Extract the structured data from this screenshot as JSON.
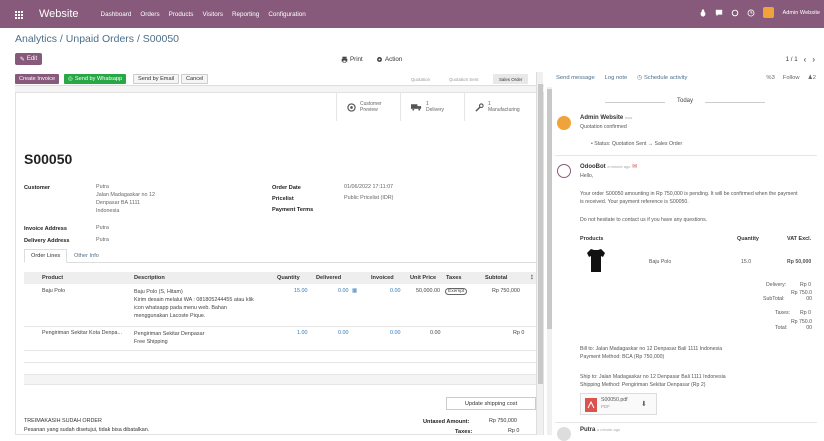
{
  "topbar": {
    "brand": "Website",
    "menus": [
      "Dashboard",
      "Orders",
      "Products",
      "Visitors",
      "Reporting",
      "Configuration"
    ],
    "user_name": "Admin Website"
  },
  "breadcrumb": "Analytics / Unpaid Orders / S00050",
  "control": {
    "edit": "Edit",
    "print": "Print",
    "action": "Action",
    "pager": "1 / 1"
  },
  "statusbar": {
    "buttons": [
      "Create Invoice",
      "Send by Whatsapp",
      "Send by Email",
      "Cancel"
    ],
    "stages": [
      "Quotation",
      "Quotation Sent",
      "Sales Order"
    ]
  },
  "smart_buttons": [
    {
      "top": "Customer",
      "bottom": "Preview"
    },
    {
      "top": "1",
      "bottom": "Delivery"
    },
    {
      "top": "1",
      "bottom": "Manufacturing"
    }
  ],
  "order": {
    "number": "S00050",
    "customer_label": "Customer",
    "customer_lines": [
      "Putra",
      "Jalan Madagaskar no 12",
      "Denpasar BA 1111",
      "Indonesia"
    ],
    "invoice_label": "Invoice Address",
    "invoice_value": "Putra",
    "delivery_label": "Delivery Address",
    "delivery_value": "Putra",
    "date_label": "Order Date",
    "date_value": "01/06/2022 17:11:07",
    "pricelist_label": "Pricelist",
    "pricelist_value": "Public Pricelist (IDR)",
    "terms_label": "Payment Terms"
  },
  "tabs": [
    "Order Lines",
    "Other Info"
  ],
  "columns": [
    "Product",
    "Description",
    "Quantity",
    "Delivered",
    "Invoiced",
    "Unit Price",
    "Taxes",
    "Subtotal"
  ],
  "lines": [
    {
      "product": "Baju Polo",
      "desc": [
        "Baju Polo (S, Hitam)",
        "Kirim desain melalui WA : 081805244455 atau klik",
        "icon whatsapp pada menu web. Bahan",
        "menggunakan Lacoste Pique."
      ],
      "qty": "15.00",
      "delivered": "0.00",
      "invoiced": "0.00",
      "price": "50,000.00",
      "tax": "Exempt",
      "subtotal": "Rp 750,000"
    },
    {
      "product": "Pengiriman Sekitar Kota Denpa...",
      "desc": [
        "Pengiriman Sekitar Denpasar",
        "Free Shipping"
      ],
      "qty": "1.00",
      "delivered": "0.00",
      "invoiced": "0.00",
      "price": "0.00",
      "tax": "",
      "subtotal": "Rp 0"
    }
  ],
  "footer": {
    "update_shipping": "Update shipping cost",
    "note1": "TREIMAKASIH SUDAH ORDER",
    "note2": "Pesanan yang sudah disetujui, tidak bisa dibatalkan.",
    "untaxed_label": "Untaxed Amount:",
    "untaxed_value": "Rp 750,000",
    "taxes_label": "Taxes:",
    "taxes_value": "Rp 0"
  },
  "chatter": {
    "send_message": "Send message",
    "log_note": "Log note",
    "schedule": "Schedule activity",
    "attach_count": "3",
    "follow": "Follow",
    "followers": "2",
    "day": "Today",
    "msg1": {
      "author": "Admin Website",
      "time": "now",
      "line1": "Quotation confirmed",
      "status": "Status: Quotation Sent → Sales Order"
    },
    "msg2": {
      "author": "OdooBot",
      "time": "a minute ago",
      "hello": "Hello,",
      "body1": "Your order S00050 amounting in Rp 750,000 is pending. It will be confirmed when the payment",
      "body2": "is received. Your payment reference is S00050.",
      "body3": "Do not hesitate to contact us if you have any questions.",
      "products_head": "Products",
      "qty_head": "Quantity",
      "vat_head": "VAT Excl.",
      "prod_name": "Baju Polo",
      "prod_qty": "15.0",
      "prod_price": "Rp 50,000",
      "delivery_label": "Delivery:",
      "delivery_value": "Rp 0",
      "subtotal_label": "SubTotal:",
      "subtotal_value": "Rp 750.0\n00",
      "taxes_label": "Taxes:",
      "taxes_value": "Rp 0",
      "total_label": "Total:",
      "total_value": "Rp 750.0\n00",
      "bill_to": "Bill to: Jalan Madagaskar no 12 Denpasar Bali 1111 Indonesia",
      "pay_method": "Payment Method: BCA (Rp 750,000)",
      "ship_to": "Ship to: Jalan Madagaskar no 12 Denpasar Bali 1111 Indonesia",
      "ship_method": "Shipping Method: Pengiriman Sekitar Denpasar (Rp 2)",
      "attachment_name": "S00050.pdf",
      "attachment_ext": "PDF"
    },
    "msg3": {
      "author": "Putra",
      "time": "a minute ago"
    }
  },
  "colors": {
    "brand": "#875a7b",
    "whatsapp": "#28a745",
    "link": "#337ab7"
  }
}
